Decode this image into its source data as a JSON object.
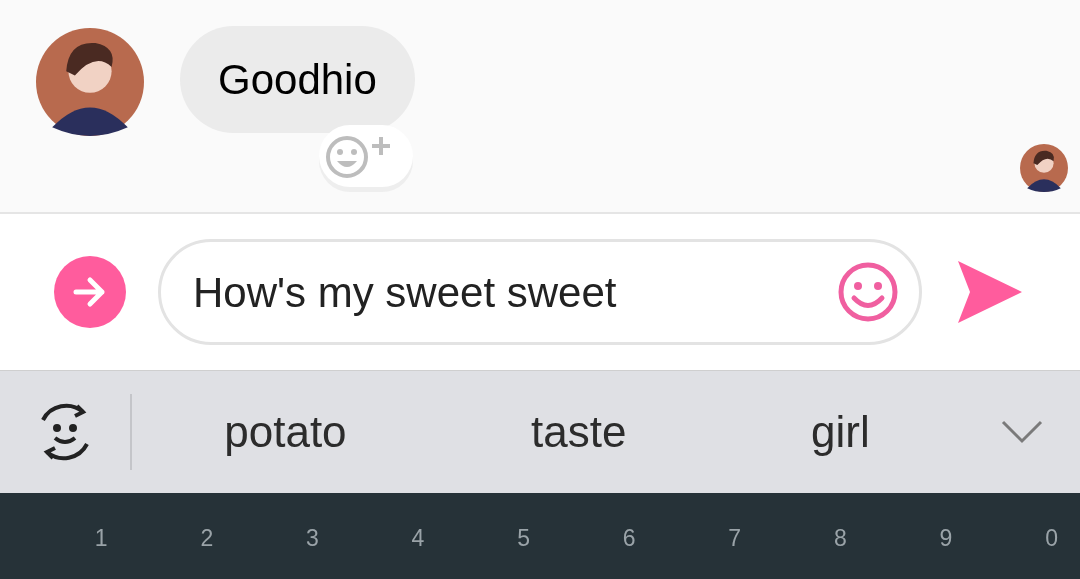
{
  "message": {
    "text": "Goodhio"
  },
  "composer": {
    "value": "How's my sweet sweet"
  },
  "suggestions": [
    "potato",
    "taste",
    "girl"
  ],
  "keyboard": {
    "digits": [
      "1",
      "2",
      "3",
      "4",
      "5",
      "6",
      "7",
      "8",
      "9",
      "0"
    ]
  }
}
